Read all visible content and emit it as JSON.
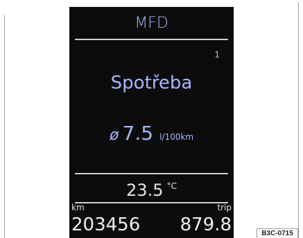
{
  "display": {
    "title": "MFD",
    "page_index": "1",
    "function_label": "Spotřeba",
    "consumption_symbol": "ø",
    "consumption_value": "7.5",
    "consumption_unit": "l/100km",
    "temperature_value": "23.5",
    "temperature_unit": "°C",
    "odometer_label": "km",
    "odometer_value": "203456",
    "trip_label": "trip",
    "trip_value": "879.8"
  },
  "figure": {
    "code": "B3C-0715"
  },
  "colors": {
    "screen_background": "#0c0c0c",
    "accent_text": "#a7b6ff",
    "primary_text": "#f0f0f0"
  }
}
